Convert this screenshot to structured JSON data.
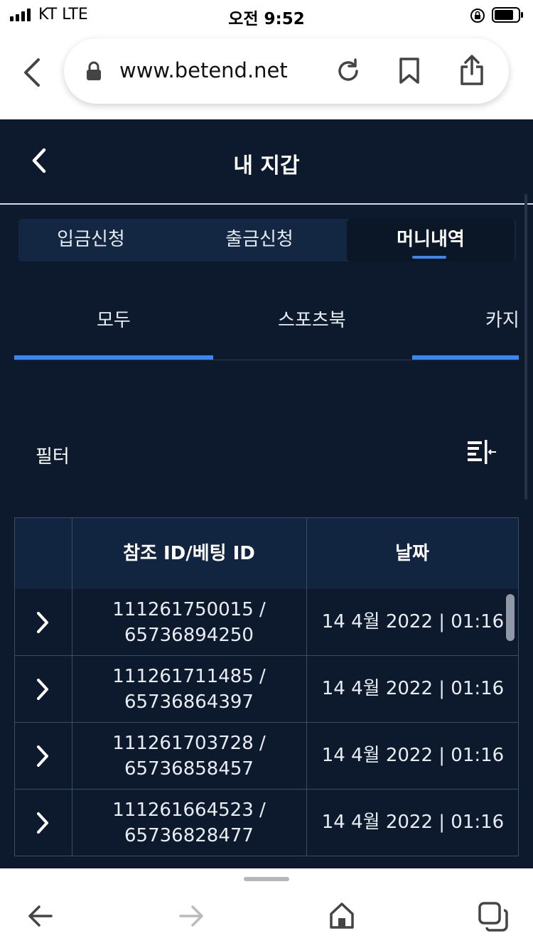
{
  "status_bar": {
    "carrier": "KT   LTE",
    "time": "오전 9:52",
    "colors": {
      "text": "#000000"
    }
  },
  "browser": {
    "url": "www.betend.net",
    "icons": [
      "back-icon",
      "lock-icon",
      "reload-icon",
      "bookmark-icon",
      "share-icon"
    ]
  },
  "header": {
    "title": "내 지갑"
  },
  "tabs": [
    {
      "label": "입금신청",
      "active": false
    },
    {
      "label": "출금신청",
      "active": false
    },
    {
      "label": "머니내역",
      "active": true
    }
  ],
  "subtabs": [
    {
      "label": "모두",
      "active": true
    },
    {
      "label": "스포츠북",
      "active": false
    },
    {
      "label": "카지",
      "active": false
    }
  ],
  "filter": {
    "label": "필터",
    "icon": "filter-collapse-icon"
  },
  "table": {
    "columns": [
      "",
      "참조 ID/베팅 ID",
      "날짜"
    ],
    "rows": [
      {
        "ref_id": "111261750015 /",
        "bet_id": "65736894250",
        "date": "14 4월 2022 | 01:16"
      },
      {
        "ref_id": "111261711485 /",
        "bet_id": "65736864397",
        "date": "14 4월 2022 | 01:16"
      },
      {
        "ref_id": "111261703728 /",
        "bet_id": "65736858457",
        "date": "14 4월 2022 | 01:16"
      },
      {
        "ref_id": "111261664523 /",
        "bet_id": "65736828477",
        "date": "14 4월 2022 | 01:16"
      }
    ]
  },
  "toolbar": {
    "icons": [
      "nav-back-icon",
      "nav-forward-icon",
      "home-icon",
      "tabs-icon"
    ]
  },
  "colors": {
    "app_bg": "#0d1a2d",
    "tab_bg": "#142742",
    "accent": "#3b86f0",
    "table_header_bg": "#112440"
  }
}
